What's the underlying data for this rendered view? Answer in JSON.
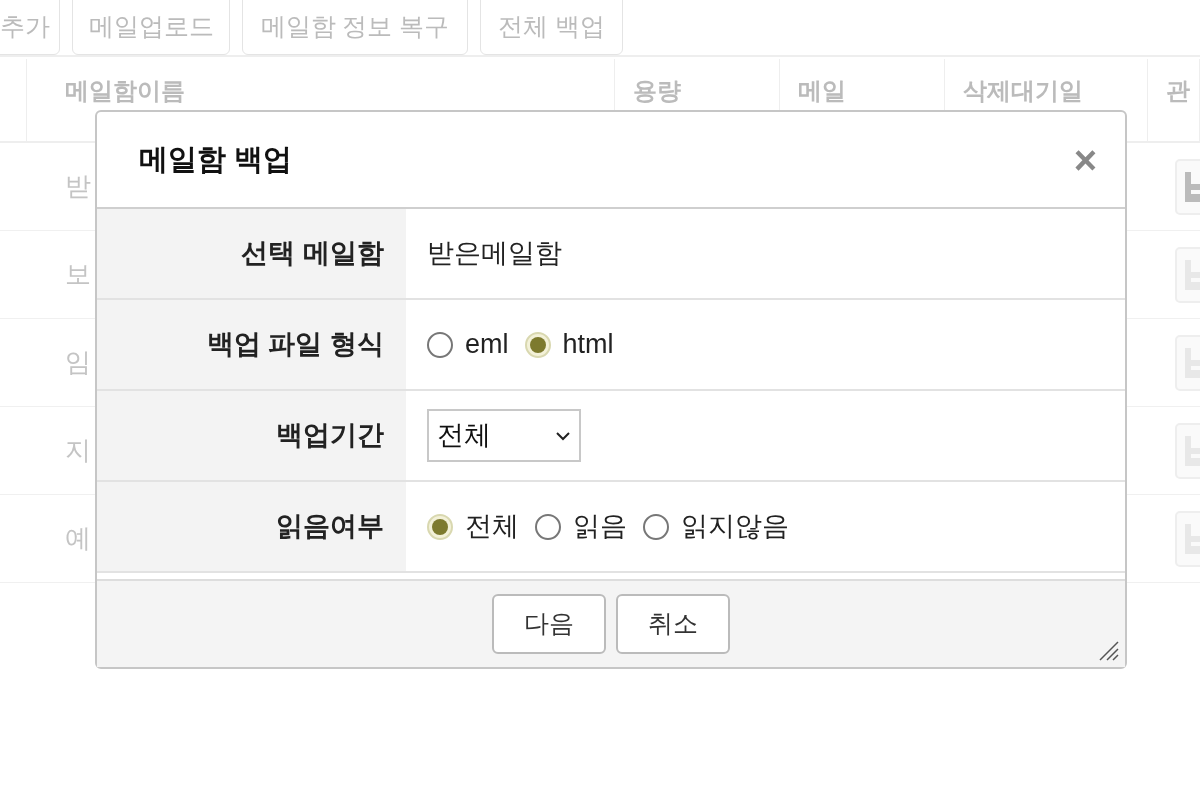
{
  "toolbar": {
    "buttons": [
      "추가",
      "메일업로드",
      "메일함 정보 복구",
      "전체 백업"
    ]
  },
  "table": {
    "columns": [
      "메일함이름",
      "용량",
      "메일",
      "삭제대기일",
      "관"
    ],
    "rows": [
      {
        "name": "받"
      },
      {
        "name": "보"
      },
      {
        "name": "임"
      },
      {
        "name": "지"
      },
      {
        "name": "예"
      }
    ]
  },
  "dialog": {
    "title": "메일함 백업",
    "close": "×",
    "fields": [
      {
        "kind": "text",
        "label": "선택 메일함",
        "value": "받은메일함"
      },
      {
        "kind": "radio",
        "label": "백업 파일 형식",
        "options": [
          {
            "label": "eml",
            "selected": false
          },
          {
            "label": "html",
            "selected": true
          }
        ]
      },
      {
        "kind": "select",
        "label": "백업기간",
        "value": "전체"
      },
      {
        "kind": "radio",
        "label": "읽음여부",
        "options": [
          {
            "label": "전체",
            "selected": true
          },
          {
            "label": "읽음",
            "selected": false
          },
          {
            "label": "읽지않음",
            "selected": false
          }
        ]
      }
    ],
    "buttons": [
      "다음",
      "취소"
    ]
  }
}
